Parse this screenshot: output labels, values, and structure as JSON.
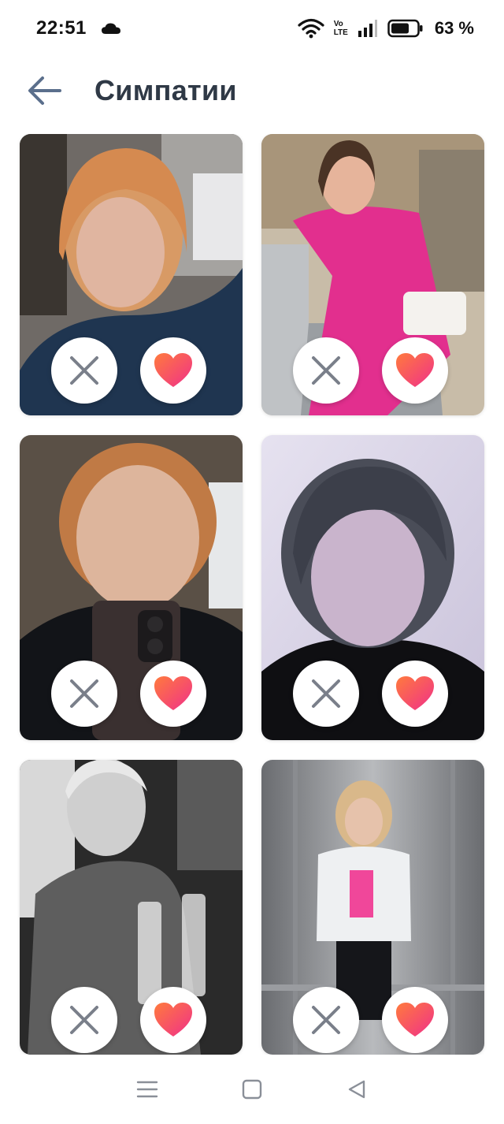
{
  "status_bar": {
    "time": "22:51",
    "weather_icon": "cloud-icon",
    "wifi_icon": "wifi-icon",
    "volte_top": "Vo",
    "volte_bottom": "LTE",
    "signal_icon": "signal-icon",
    "battery_icon": "battery-icon",
    "battery_percent": "63 %"
  },
  "header": {
    "back_icon": "arrow-left-icon",
    "title": "Симпатии"
  },
  "cards": [
    {
      "photo": "photo-woman-auburn-bob",
      "dislike_icon": "close-icon",
      "like_icon": "heart-icon"
    },
    {
      "photo": "photo-woman-pink-suit",
      "dislike_icon": "close-icon",
      "like_icon": "heart-icon"
    },
    {
      "photo": "photo-woman-phone-selfie",
      "dislike_icon": "close-icon",
      "like_icon": "heart-icon"
    },
    {
      "photo": "photo-woman-dark-curly-hair",
      "dislike_icon": "close-icon",
      "like_icon": "heart-icon"
    },
    {
      "photo": "photo-woman-champagne-bw",
      "dislike_icon": "close-icon",
      "like_icon": "heart-icon"
    },
    {
      "photo": "photo-woman-elevator-selfie",
      "dislike_icon": "close-icon",
      "like_icon": "heart-icon"
    }
  ],
  "nav_bar": {
    "menu_icon": "menu-icon",
    "home_icon": "square-home-icon",
    "back_icon": "triangle-back-icon"
  },
  "colors": {
    "title": "#2f3946",
    "back_arrow": "#5b6f8c",
    "close_icon": "#7a7f8a",
    "heart_gradient_start": "#ff7a3d",
    "heart_gradient_end": "#f0308a"
  }
}
